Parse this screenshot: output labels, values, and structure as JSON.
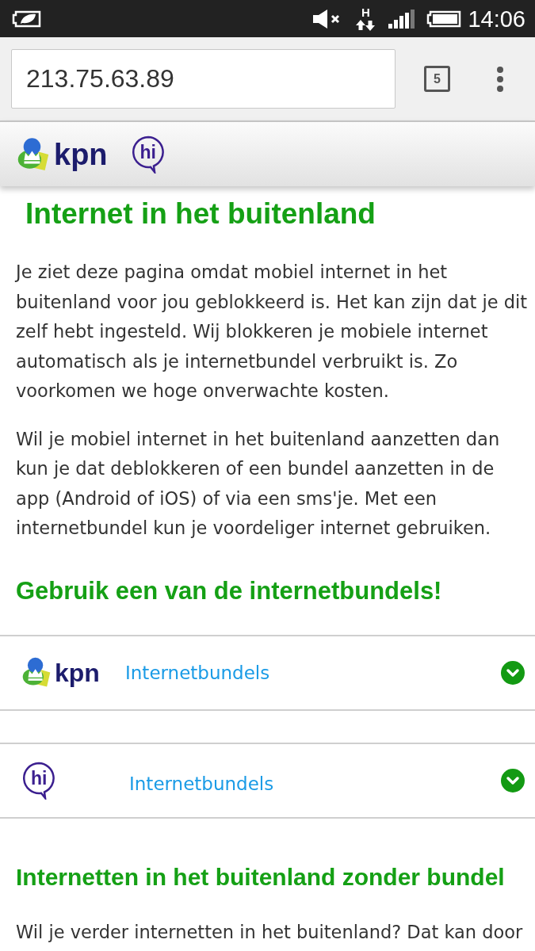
{
  "status_bar": {
    "network_type": "H",
    "time": "14:06"
  },
  "browser": {
    "url": "213.75.63.89",
    "tab_count": "5"
  },
  "site_header": {
    "logos": [
      {
        "kind": "kpn",
        "text": "kpn"
      },
      {
        "kind": "hi",
        "text": "hi"
      }
    ]
  },
  "title": "Internet in het buitenland",
  "intro_paragraphs": [
    "Je ziet deze pagina omdat mobiel internet in het buitenland voor jou geblokkeerd is. Het kan zijn dat je dit zelf hebt ingesteld. Wij blokkeren je mobiele internet automatisch als je internetbundel verbruikt is. Zo voorkomen we hoge onverwachte kosten.",
    "Wil je mobiel internet in het buitenland aanzetten dan kun je dat deblokkeren of een bundel aanzetten in de app (Android of iOS) of via een sms'je. Met een internetbundel kun je voordeliger internet gebruiken."
  ],
  "bundles_heading": "Gebruik een van de internetbundels!",
  "bundles": [
    {
      "kind": "kpn",
      "logo_text": "kpn",
      "link": "Internetbundels",
      "expanded": false
    },
    {
      "kind": "hi",
      "logo_text": "hi",
      "link": "Internetbundels",
      "expanded": false
    }
  ],
  "no_bundle_heading": "Internetten in het buitenland zonder bundel",
  "no_bundle_paragraphs": [
    "Wil je verder internetten in het buitenland? Dat kan door"
  ]
}
